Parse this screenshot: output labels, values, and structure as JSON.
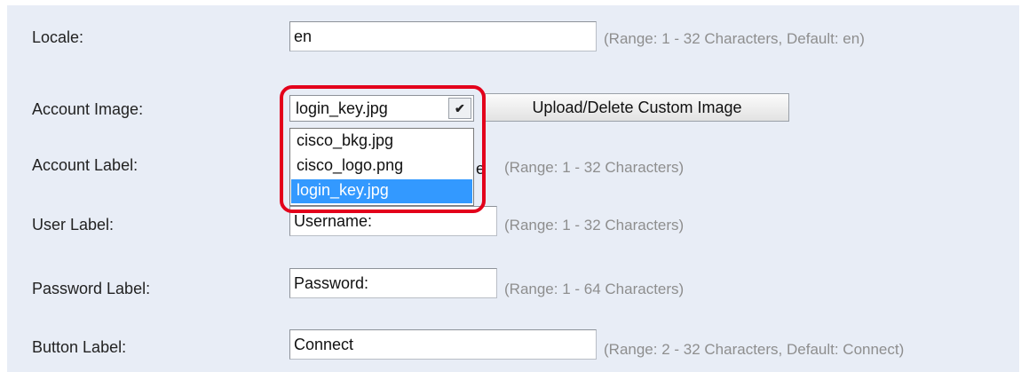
{
  "form": {
    "locale": {
      "label": "Locale:",
      "value": "en",
      "hint": "(Range: 1 - 32 Characters, Default: en)"
    },
    "account_image": {
      "label": "Account Image:",
      "selected": "login_key.jpg",
      "upload_button": "Upload/Delete Custom Image",
      "options": [
        "cisco_bkg.jpg",
        "cisco_logo.png",
        "login_key.jpg"
      ]
    },
    "account_label": {
      "label": "Account Label:",
      "value_peek": "e",
      "hint": "(Range: 1 - 32 Characters)"
    },
    "user_label": {
      "label": "User Label:",
      "value": "Username:",
      "hint": "(Range: 1 - 32 Characters)"
    },
    "password_label": {
      "label": "Password Label:",
      "value": "Password:",
      "hint": "(Range: 1 - 64 Characters)"
    },
    "button_label": {
      "label": "Button Label:",
      "value": "Connect",
      "hint": "(Range: 2 - 32 Characters, Default: Connect)"
    }
  },
  "colors": {
    "panel_bg": "#e8edf6",
    "highlight": "#e3001b",
    "selected_option": "#3399ff"
  }
}
